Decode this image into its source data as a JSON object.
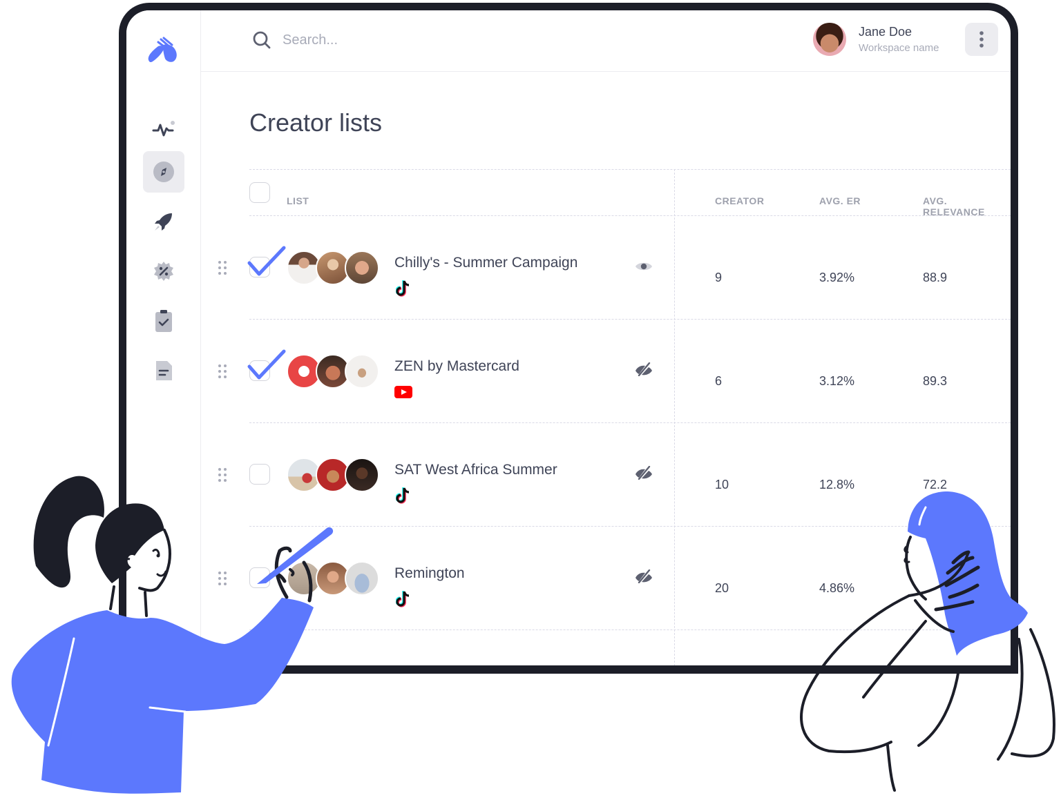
{
  "header": {
    "search": {
      "placeholder": "Search..."
    },
    "user": {
      "name": "Jane Doe",
      "workspace": "Workspace name"
    }
  },
  "sidebar": {
    "items": [
      {
        "icon": "activity-pulse-icon",
        "active": false
      },
      {
        "icon": "compass-icon",
        "active": true
      },
      {
        "icon": "rocket-icon",
        "active": false
      },
      {
        "icon": "discount-badge-icon",
        "active": false
      },
      {
        "icon": "clipboard-check-icon",
        "active": false
      },
      {
        "icon": "document-icon",
        "active": false
      }
    ]
  },
  "main": {
    "title": "Creator lists",
    "table": {
      "columns": {
        "list": "LIST",
        "creator": "CREATOR",
        "avg_er": "AVG. ER",
        "avg_relevance": "AVG. RELEVANCE"
      },
      "rows": [
        {
          "name": "Chilly's - Summer Campaign",
          "platform": "tiktok",
          "visible": true,
          "checked": true,
          "creator": "9",
          "avg_er": "3.92%",
          "avg_relevance": "88.9"
        },
        {
          "name": "ZEN by Mastercard",
          "platform": "youtube",
          "visible": false,
          "checked": true,
          "creator": "6",
          "avg_er": "3.12%",
          "avg_relevance": "89.3"
        },
        {
          "name": "SAT West Africa Summer",
          "platform": "tiktok",
          "visible": false,
          "checked": false,
          "creator": "10",
          "avg_er": "12.8%",
          "avg_relevance": "72.2"
        },
        {
          "name": "Remington",
          "platform": "tiktok",
          "visible": false,
          "checked": false,
          "creator": "20",
          "avg_er": "4.86%",
          "avg_relevance": ""
        }
      ]
    }
  },
  "colors": {
    "accent": "#5c78fd",
    "frame": "#1c1e28",
    "text": "#3f4457",
    "muted": "#a8abb8",
    "youtube": "#ff0000"
  }
}
